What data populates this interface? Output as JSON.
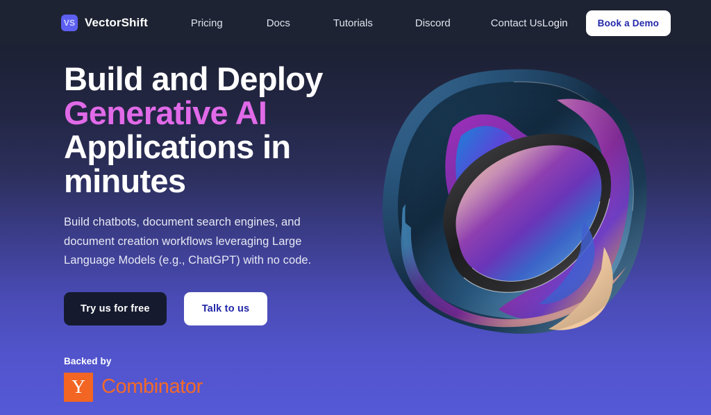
{
  "brand": {
    "logo_text": "VS",
    "logo_icon": "vectorshift-logo-icon",
    "name": "VectorShift",
    "logo_bg": "#5d5ff0"
  },
  "nav": {
    "links": [
      {
        "label": "Pricing"
      },
      {
        "label": "Docs"
      },
      {
        "label": "Tutorials"
      },
      {
        "label": "Discord"
      },
      {
        "label": "Contact Us"
      }
    ],
    "login_label": "Login",
    "demo_label": "Book a Demo"
  },
  "hero": {
    "headline_line1": "Build and Deploy",
    "headline_accent": "Generative AI",
    "headline_line3": "Applications in",
    "headline_line4": "minutes",
    "accent_color": "#e06ae8",
    "subhead": "Build chatbots, document search engines, and document creation workflows leveraging Large Language Models (e.g., ChatGPT) with no code.",
    "primary_cta": "Try us for free",
    "secondary_cta": "Talk to us",
    "backed_label": "Backed by",
    "yc_mark": "Y",
    "yc_name": "Combinator",
    "yc_color": "#f26522",
    "art_name": "abstract-layered-blob-graphic"
  },
  "theme": {
    "bg_top": "#1c2033",
    "bg_bottom": "#5659d6",
    "navbar_bg": "#1e2333",
    "button_dark": "#151a2e",
    "button_text_blue": "#2226a8"
  }
}
